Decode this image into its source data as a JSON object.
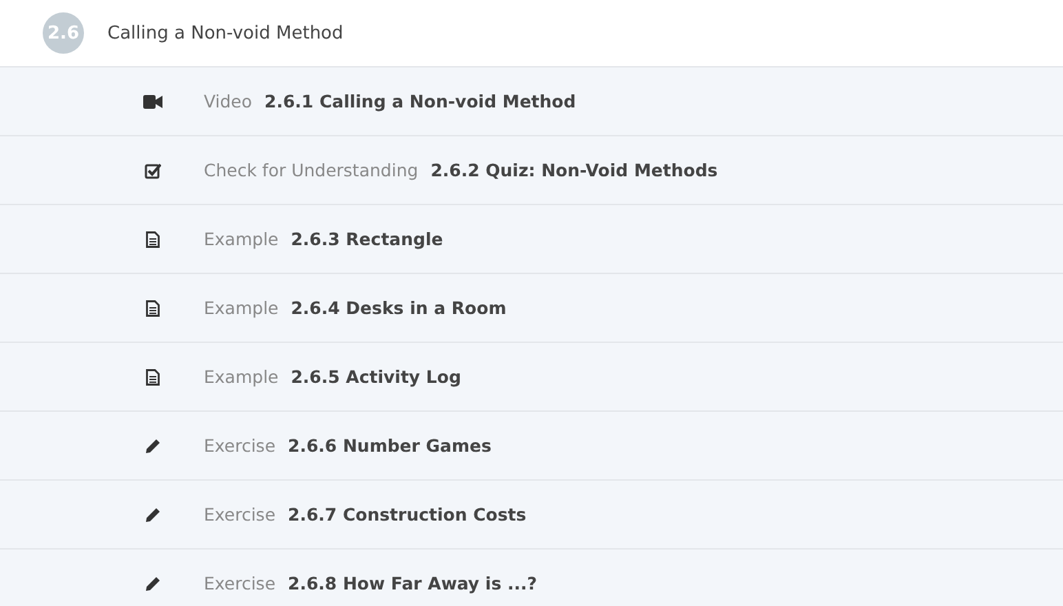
{
  "section": {
    "number": "2.6",
    "title": "Calling a Non-void Method"
  },
  "items": [
    {
      "kind": "video",
      "type_label": "Video",
      "title": "2.6.1 Calling a Non-void Method"
    },
    {
      "kind": "quiz",
      "type_label": "Check for Understanding",
      "title": "2.6.2 Quiz: Non-Void Methods"
    },
    {
      "kind": "example",
      "type_label": "Example",
      "title": "2.6.3 Rectangle"
    },
    {
      "kind": "example",
      "type_label": "Example",
      "title": "2.6.4 Desks in a Room"
    },
    {
      "kind": "example",
      "type_label": "Example",
      "title": "2.6.5 Activity Log"
    },
    {
      "kind": "exercise",
      "type_label": "Exercise",
      "title": "2.6.6 Number Games"
    },
    {
      "kind": "exercise",
      "type_label": "Exercise",
      "title": "2.6.7 Construction Costs"
    },
    {
      "kind": "exercise",
      "type_label": "Exercise",
      "title": "2.6.8 How Far Away is ...?"
    }
  ]
}
